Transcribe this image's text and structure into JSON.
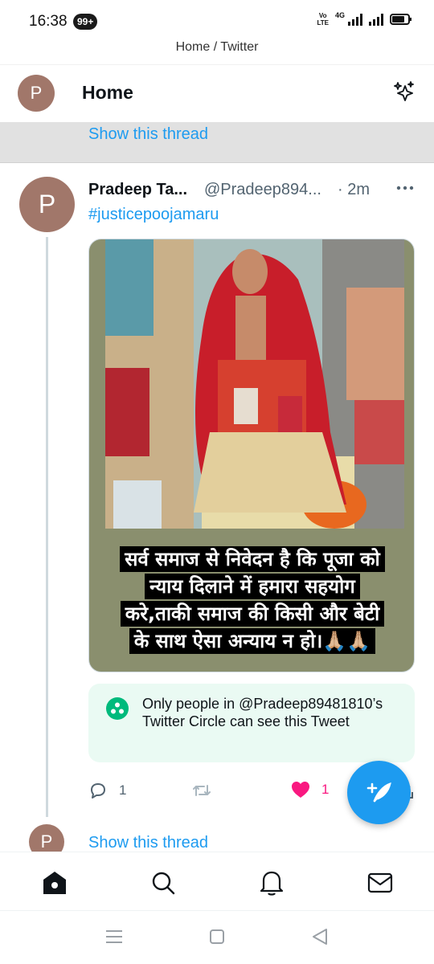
{
  "status_bar": {
    "time": "16:38",
    "notification_badge": "99+",
    "volte": "Vo LTE",
    "network": "4G",
    "battery_level": 0.8
  },
  "browser": {
    "url_title": "Home / Twitter"
  },
  "header": {
    "avatar_initial": "P",
    "title": "Home",
    "sparkle_icon": "sparkle-icon"
  },
  "thread_banner": {
    "label": "Show this thread"
  },
  "tweet": {
    "avatar_initial": "P",
    "name": "Pradeep Ta...",
    "handle": "@Pradeep894...",
    "time": "· 2m",
    "hashtag": "#justicepoojamaru",
    "image_caption_lines": [
      "सर्व समाज से निवेदन है कि पूजा को",
      "न्याय दिलाने में हमारा सहयोग",
      "करे,ताकी समाज की किसी और बेटी",
      "के साथ ऐसा अन्याय न हो।🙏🏼🙏🏼"
    ],
    "circle_notice": "Only people in @Pradeep89481810’s Twitter Circle can see this Tweet",
    "reply_count": "1",
    "retweet_count": "",
    "like_count": "1",
    "liked": true
  },
  "next_tweet": {
    "avatar_initial": "P",
    "label": "Show this thread"
  },
  "compose": {
    "icon": "compose-plus-feather-icon"
  },
  "bottom_nav": {
    "items": [
      "home-icon",
      "search-icon",
      "notifications-bell-icon",
      "messages-envelope-icon"
    ]
  },
  "system_nav": {
    "items": [
      "menu-icon",
      "home-square-icon",
      "back-triangle-icon"
    ]
  },
  "colors": {
    "accent": "#1d9bf0",
    "like": "#f91880",
    "circle_green": "#00ba7c",
    "circle_bg": "#eafaf3",
    "avatar": "#a1776a"
  }
}
